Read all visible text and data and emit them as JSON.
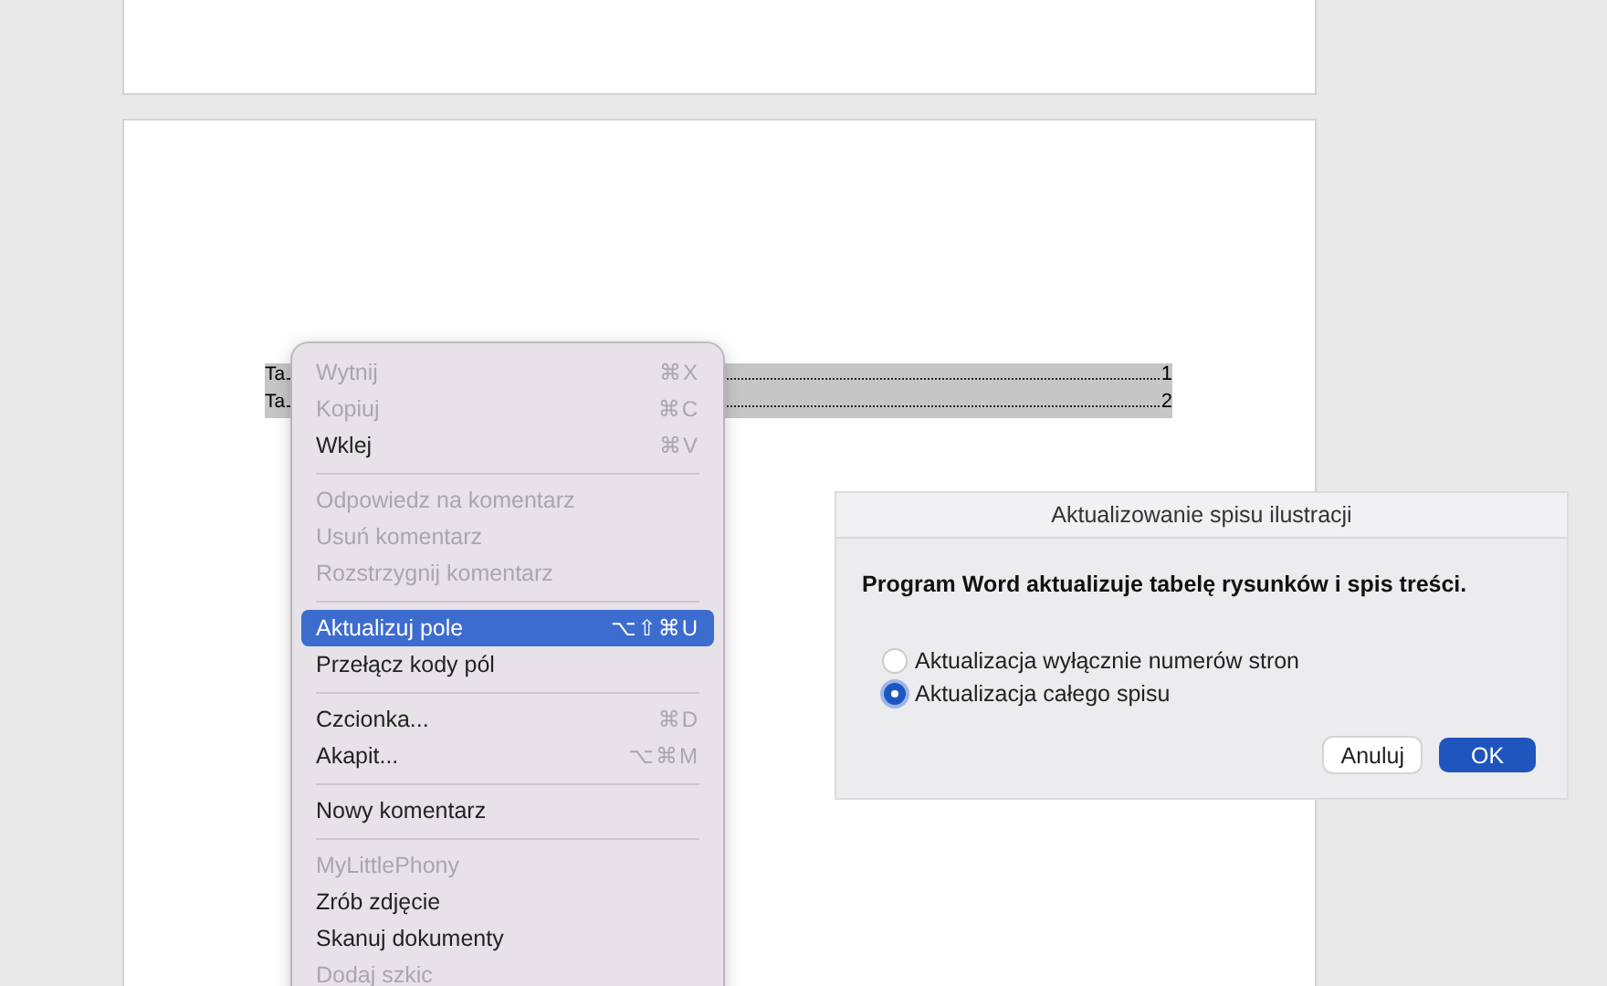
{
  "document": {
    "toc_rows": [
      {
        "label": "Ta",
        "page": "1"
      },
      {
        "label": "Ta",
        "page": "2"
      }
    ]
  },
  "context_menu": {
    "groups": [
      {
        "items": [
          {
            "label": "Wytnij",
            "shortcut": "⌘X",
            "disabled": true,
            "selected": false
          },
          {
            "label": "Kopiuj",
            "shortcut": "⌘C",
            "disabled": true,
            "selected": false
          },
          {
            "label": "Wklej",
            "shortcut": "⌘V",
            "disabled": false,
            "selected": false
          }
        ]
      },
      {
        "items": [
          {
            "label": "Odpowiedz na komentarz",
            "disabled": true,
            "selected": false
          },
          {
            "label": "Usuń komentarz",
            "disabled": true,
            "selected": false
          },
          {
            "label": "Rozstrzygnij komentarz",
            "disabled": true,
            "selected": false
          }
        ]
      },
      {
        "items": [
          {
            "label": "Aktualizuj pole",
            "shortcut": "⌥⇧⌘U",
            "disabled": false,
            "selected": true
          },
          {
            "label": "Przełącz kody pól",
            "disabled": false,
            "selected": false
          }
        ]
      },
      {
        "items": [
          {
            "label": "Czcionka...",
            "shortcut": "⌘D",
            "disabled": false,
            "selected": false
          },
          {
            "label": "Akapit...",
            "shortcut": "⌥⌘M",
            "disabled": false,
            "selected": false
          }
        ]
      },
      {
        "items": [
          {
            "label": "Nowy komentarz",
            "disabled": false,
            "selected": false
          }
        ]
      },
      {
        "items": [
          {
            "label": "MyLittlePhony",
            "disabled": true,
            "selected": false
          },
          {
            "label": "Zrób zdjęcie",
            "disabled": false,
            "selected": false
          },
          {
            "label": "Skanuj dokumenty",
            "disabled": false,
            "selected": false
          },
          {
            "label": "Dodaj szkic",
            "disabled": true,
            "selected": false
          }
        ]
      }
    ]
  },
  "dialog": {
    "title": "Aktualizowanie spisu ilustracji",
    "message": "Program Word aktualizuje tabelę rysunków i spis treści.",
    "options": [
      {
        "label": "Aktualizacja wyłącznie numerów stron",
        "selected": false
      },
      {
        "label": "Aktualizacja całego spisu",
        "selected": true
      }
    ],
    "buttons": [
      {
        "label": "Anuluj",
        "kind": "cancel"
      },
      {
        "label": "OK",
        "kind": "default"
      }
    ]
  }
}
